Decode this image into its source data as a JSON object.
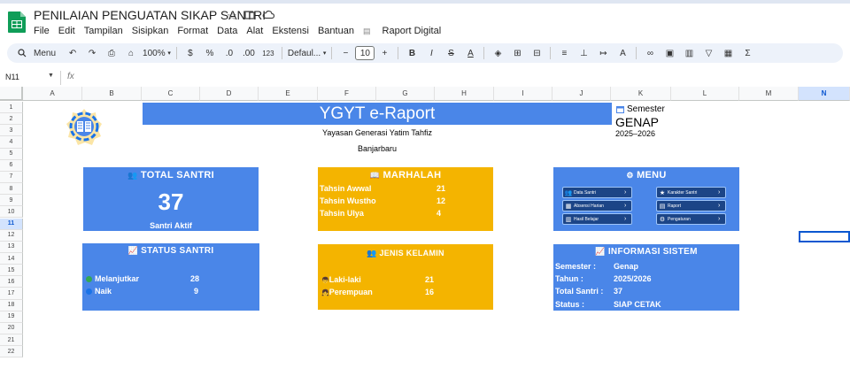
{
  "app": {
    "doc_title": "PENILAIAN PENGUATAN SIKAP SANTRI",
    "menus": [
      "File",
      "Edit",
      "Tampilan",
      "Sisipkan",
      "Format",
      "Data",
      "Alat",
      "Ekstensi",
      "Bantuan"
    ],
    "extra_menu": "Raport Digital"
  },
  "toolbar": {
    "menu_label": "Menu",
    "zoom": "100%",
    "currency": "$",
    "percent": "%",
    "dec_less": ".0",
    "dec_more": ".00",
    "num_format": "123",
    "font_name": "Defaul...",
    "font_size": "10",
    "bold": "B",
    "italic": "I",
    "strike": "S",
    "text_color": "A",
    "sum": "Σ"
  },
  "formula_bar": {
    "cell_ref": "N11",
    "fx": "fx",
    "value": ""
  },
  "grid": {
    "columns": [
      "A",
      "B",
      "C",
      "D",
      "E",
      "F",
      "G",
      "H",
      "I",
      "J",
      "K",
      "L",
      "M",
      "N"
    ],
    "rows": [
      "1",
      "2",
      "3",
      "4",
      "5",
      "6",
      "7",
      "8",
      "9",
      "10",
      "11",
      "12",
      "13",
      "14",
      "15",
      "16",
      "17",
      "18",
      "19",
      "20",
      "21",
      "22"
    ],
    "selected_column": "N",
    "selected_row": "11"
  },
  "dashboard": {
    "banner": "YGYT e-Raport",
    "org_name": "Yayasan Generasi Yatim Tahfiz",
    "city": "Banjarbaru",
    "semester_label": "Semester",
    "semester_value": "GENAP",
    "year": "2025–2026",
    "total_santri": {
      "title": "TOTAL SANTRI",
      "value": "37",
      "caption": "Santri Aktif"
    },
    "marhalah": {
      "title": "MARHALAH",
      "items": [
        {
          "label": "Tahsin Awwal",
          "value": "21"
        },
        {
          "label": "Tahsin Wustho",
          "value": "12"
        },
        {
          "label": "Tahsin Ulya",
          "value": "4"
        }
      ]
    },
    "menu": {
      "title": "MENU",
      "buttons": [
        {
          "label": "Data Santri",
          "icon": "users-icon"
        },
        {
          "label": "Karakter Santri",
          "icon": "star-icon"
        },
        {
          "label": "Absensi Harian",
          "icon": "calendar-icon"
        },
        {
          "label": "Raport",
          "icon": "document-icon"
        },
        {
          "label": "Hasil Belajar",
          "icon": "book-icon"
        },
        {
          "label": "Pengaturan",
          "icon": "gear-icon"
        }
      ]
    },
    "status_santri": {
      "title": "STATUS SANTRI",
      "items": [
        {
          "label": "Melanjutkar",
          "value": "28",
          "color": "#34a853"
        },
        {
          "label": "Naik",
          "value": "9",
          "color": "#1a73e8"
        }
      ]
    },
    "jenis_kelamin": {
      "title": "JENIS KELAMIN",
      "items": [
        {
          "label": "Laki-laki",
          "value": "21"
        },
        {
          "label": "Perempuan",
          "value": "16"
        }
      ]
    },
    "info": {
      "title": "INFORMASI SISTEM",
      "rows": [
        {
          "label": "Semester :",
          "value": "Genap"
        },
        {
          "label": "Tahun :",
          "value": "2025/2026"
        },
        {
          "label": "Total Santri :",
          "value": "37"
        },
        {
          "label": "Status :",
          "value": "SIAP CETAK"
        }
      ]
    }
  },
  "colors": {
    "blue_card": "#4a86e8",
    "gold_card": "#f4b400",
    "menu_button": "#1c4587",
    "selection": "#0b57d0"
  }
}
